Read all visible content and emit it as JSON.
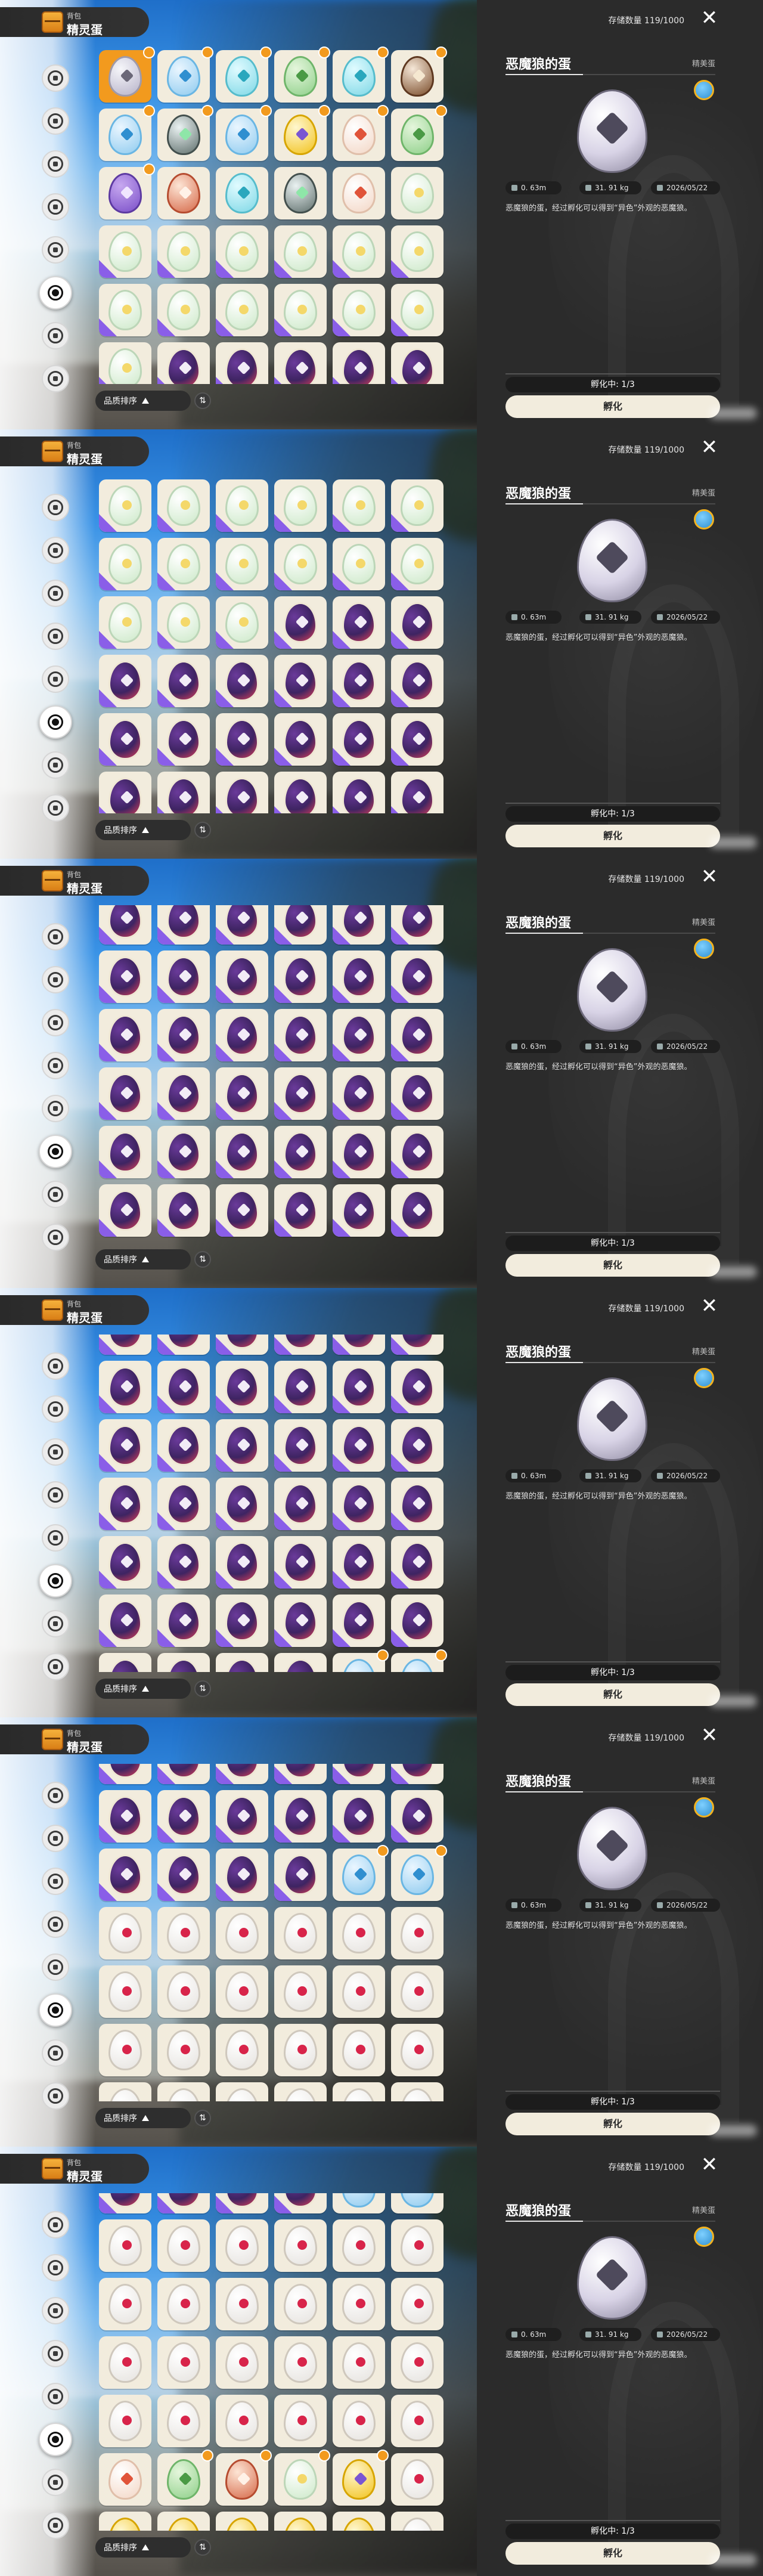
{
  "ui": {
    "category": "背包",
    "title": "精灵蛋",
    "storage": "存储数量 119/1000",
    "sort_label": "品质排序",
    "swap_glyph": "⇅",
    "close_glyph": "✕"
  },
  "detail": {
    "name": "恶魔狼的蛋",
    "kind": "精美蛋",
    "stat_size": "0. 63m",
    "stat_weight": "31. 91 kg",
    "stat_date": "2026/05/22",
    "description": "恶魔狼的蛋，经过孵化可以得到“异色”外观的恶魔狼。",
    "hatch_status": "孵化中: 1/3",
    "hatch_button": "孵化"
  },
  "sidebar": {
    "icons": [
      "ball-icon",
      "wing-icon",
      "leaf-icon",
      "drop-icon",
      "shield-icon",
      "egg-icon",
      "helmet-icon",
      "skull-icon"
    ],
    "active_index": 5
  },
  "views": [
    {
      "offset": 0,
      "rows": [
        [
          {
            "c": "grey",
            "sel": true,
            "b": true
          },
          {
            "c": "blue",
            "b": true
          },
          {
            "c": "cyan",
            "b": true
          },
          {
            "c": "green",
            "b": true
          },
          {
            "c": "cyan",
            "b": true
          },
          {
            "c": "brown",
            "b": true
          }
        ],
        [
          {
            "c": "blue",
            "b": true
          },
          {
            "c": "teal",
            "b": true
          },
          {
            "c": "blue",
            "b": true
          },
          {
            "c": "yellow",
            "b": true
          },
          {
            "c": "peach",
            "b": true
          },
          {
            "c": "green",
            "b": true
          }
        ],
        [
          {
            "c": "purple",
            "b": true
          },
          {
            "c": "red"
          },
          {
            "c": "cyan"
          },
          {
            "c": "teal"
          },
          {
            "c": "peach"
          },
          {
            "c": "mint"
          }
        ],
        [
          {
            "c": "mint",
            "t": true
          },
          {
            "c": "mint",
            "t": true
          },
          {
            "c": "mint",
            "t": true
          },
          {
            "c": "mint",
            "t": true
          },
          {
            "c": "mint",
            "t": true
          },
          {
            "c": "mint",
            "t": true
          }
        ],
        [
          {
            "c": "mint",
            "t": true
          },
          {
            "c": "mint",
            "t": true
          },
          {
            "c": "mint",
            "t": true
          },
          {
            "c": "mint",
            "t": true
          },
          {
            "c": "mint",
            "t": true
          },
          {
            "c": "mint",
            "t": true
          }
        ],
        [
          {
            "c": "mint",
            "t": true
          },
          {
            "c": "dark",
            "t": true
          },
          {
            "c": "dark",
            "t": true
          },
          {
            "c": "dark",
            "t": true
          },
          {
            "c": "dark",
            "t": true
          },
          {
            "c": "dark",
            "t": true
          }
        ]
      ]
    },
    {
      "offset": 0,
      "rows": [
        [
          {
            "c": "mint",
            "t": true
          },
          {
            "c": "mint",
            "t": true
          },
          {
            "c": "mint",
            "t": true
          },
          {
            "c": "mint",
            "t": true
          },
          {
            "c": "mint",
            "t": true
          },
          {
            "c": "mint",
            "t": true
          }
        ],
        [
          {
            "c": "mint",
            "t": true
          },
          {
            "c": "mint",
            "t": true
          },
          {
            "c": "mint",
            "t": true
          },
          {
            "c": "mint",
            "t": true
          },
          {
            "c": "mint",
            "t": true
          },
          {
            "c": "mint",
            "t": true
          }
        ],
        [
          {
            "c": "mint",
            "t": true
          },
          {
            "c": "mint",
            "t": true
          },
          {
            "c": "mint",
            "t": true
          },
          {
            "c": "dark",
            "t": true
          },
          {
            "c": "dark",
            "t": true
          },
          {
            "c": "dark",
            "t": true
          }
        ],
        [
          {
            "c": "dark",
            "t": true
          },
          {
            "c": "dark",
            "t": true
          },
          {
            "c": "dark",
            "t": true
          },
          {
            "c": "dark",
            "t": true
          },
          {
            "c": "dark",
            "t": true
          },
          {
            "c": "dark",
            "t": true
          }
        ],
        [
          {
            "c": "dark",
            "t": true
          },
          {
            "c": "dark",
            "t": true
          },
          {
            "c": "dark",
            "t": true
          },
          {
            "c": "dark",
            "t": true
          },
          {
            "c": "dark",
            "t": true
          },
          {
            "c": "dark",
            "t": true
          }
        ],
        [
          {
            "c": "dark",
            "t": true
          },
          {
            "c": "dark",
            "t": true
          },
          {
            "c": "dark",
            "t": true
          },
          {
            "c": "dark",
            "t": true
          },
          {
            "c": "dark",
            "t": true
          },
          {
            "c": "dark",
            "t": true
          }
        ]
      ]
    },
    {
      "offset": -28,
      "rows": [
        [
          {
            "c": "dark",
            "t": true
          },
          {
            "c": "dark",
            "t": true
          },
          {
            "c": "dark",
            "t": true
          },
          {
            "c": "dark",
            "t": true
          },
          {
            "c": "dark",
            "t": true
          },
          {
            "c": "dark",
            "t": true
          }
        ],
        [
          {
            "c": "dark",
            "t": true
          },
          {
            "c": "dark",
            "t": true
          },
          {
            "c": "dark",
            "t": true
          },
          {
            "c": "dark",
            "t": true
          },
          {
            "c": "dark",
            "t": true
          },
          {
            "c": "dark",
            "t": true
          }
        ],
        [
          {
            "c": "dark",
            "t": true
          },
          {
            "c": "dark",
            "t": true
          },
          {
            "c": "dark",
            "t": true
          },
          {
            "c": "dark",
            "t": true
          },
          {
            "c": "dark",
            "t": true
          },
          {
            "c": "dark",
            "t": true
          }
        ],
        [
          {
            "c": "dark",
            "t": true
          },
          {
            "c": "dark",
            "t": true
          },
          {
            "c": "dark",
            "t": true
          },
          {
            "c": "dark",
            "t": true
          },
          {
            "c": "dark",
            "t": true
          },
          {
            "c": "dark",
            "t": true
          }
        ],
        [
          {
            "c": "dark",
            "t": true
          },
          {
            "c": "dark",
            "t": true
          },
          {
            "c": "dark",
            "t": true
          },
          {
            "c": "dark",
            "t": true
          },
          {
            "c": "dark",
            "t": true
          },
          {
            "c": "dark",
            "t": true
          }
        ],
        [
          {
            "c": "dark",
            "t": true
          },
          {
            "c": "dark",
            "t": true
          },
          {
            "c": "dark",
            "t": true
          },
          {
            "c": "dark",
            "t": true
          },
          {
            "c": "dark",
            "t": true
          },
          {
            "c": "dark",
            "t": true
          }
        ],
        [
          {
            "c": "dark",
            "t": true
          },
          {
            "c": "dark",
            "t": true
          },
          {
            "c": "dark",
            "t": true
          },
          {
            "c": "dark",
            "t": true
          },
          {
            "c": "dark",
            "t": true
          },
          {
            "c": "dark",
            "t": true
          }
        ]
      ]
    },
    {
      "offset": -60,
      "rows": [
        [
          {
            "c": "dark",
            "t": true
          },
          {
            "c": "dark",
            "t": true
          },
          {
            "c": "dark",
            "t": true
          },
          {
            "c": "dark",
            "t": true
          },
          {
            "c": "dark",
            "t": true
          },
          {
            "c": "dark",
            "t": true
          }
        ],
        [
          {
            "c": "dark",
            "t": true
          },
          {
            "c": "dark",
            "t": true
          },
          {
            "c": "dark",
            "t": true
          },
          {
            "c": "dark",
            "t": true
          },
          {
            "c": "dark",
            "t": true
          },
          {
            "c": "dark",
            "t": true
          }
        ],
        [
          {
            "c": "dark",
            "t": true
          },
          {
            "c": "dark",
            "t": true
          },
          {
            "c": "dark",
            "t": true
          },
          {
            "c": "dark",
            "t": true
          },
          {
            "c": "dark",
            "t": true
          },
          {
            "c": "dark",
            "t": true
          }
        ],
        [
          {
            "c": "dark",
            "t": true
          },
          {
            "c": "dark",
            "t": true
          },
          {
            "c": "dark",
            "t": true
          },
          {
            "c": "dark",
            "t": true
          },
          {
            "c": "dark",
            "t": true
          },
          {
            "c": "dark",
            "t": true
          }
        ],
        [
          {
            "c": "dark",
            "t": true
          },
          {
            "c": "dark",
            "t": true
          },
          {
            "c": "dark",
            "t": true
          },
          {
            "c": "dark",
            "t": true
          },
          {
            "c": "dark",
            "t": true
          },
          {
            "c": "dark",
            "t": true
          }
        ],
        [
          {
            "c": "dark",
            "t": true
          },
          {
            "c": "dark",
            "t": true
          },
          {
            "c": "dark",
            "t": true
          },
          {
            "c": "dark",
            "t": true
          },
          {
            "c": "dark",
            "t": true
          },
          {
            "c": "dark",
            "t": true
          }
        ],
        [
          {
            "c": "dark",
            "t": true
          },
          {
            "c": "dark",
            "t": true
          },
          {
            "c": "dark",
            "t": true
          },
          {
            "c": "dark",
            "t": true
          },
          {
            "c": "blue",
            "b": true
          },
          {
            "c": "blue",
            "b": true
          }
        ]
      ]
    },
    {
      "offset": -60,
      "rows": [
        [
          {
            "c": "dark",
            "t": true
          },
          {
            "c": "dark",
            "t": true
          },
          {
            "c": "dark",
            "t": true
          },
          {
            "c": "dark",
            "t": true
          },
          {
            "c": "dark",
            "t": true
          },
          {
            "c": "dark",
            "t": true
          }
        ],
        [
          {
            "c": "dark",
            "t": true
          },
          {
            "c": "dark",
            "t": true
          },
          {
            "c": "dark",
            "t": true
          },
          {
            "c": "dark",
            "t": true
          },
          {
            "c": "dark",
            "t": true
          },
          {
            "c": "dark",
            "t": true
          }
        ],
        [
          {
            "c": "dark",
            "t": true
          },
          {
            "c": "dark",
            "t": true
          },
          {
            "c": "dark",
            "t": true
          },
          {
            "c": "dark",
            "t": true
          },
          {
            "c": "blue",
            "b": true
          },
          {
            "c": "blue",
            "b": true
          }
        ],
        [
          {
            "c": "white"
          },
          {
            "c": "white"
          },
          {
            "c": "white"
          },
          {
            "c": "white"
          },
          {
            "c": "white"
          },
          {
            "c": "white"
          }
        ],
        [
          {
            "c": "white"
          },
          {
            "c": "white"
          },
          {
            "c": "white"
          },
          {
            "c": "white"
          },
          {
            "c": "white"
          },
          {
            "c": "white"
          }
        ],
        [
          {
            "c": "white"
          },
          {
            "c": "white"
          },
          {
            "c": "white"
          },
          {
            "c": "white"
          },
          {
            "c": "white"
          },
          {
            "c": "white"
          }
        ],
        [
          {
            "c": "white"
          },
          {
            "c": "white"
          },
          {
            "c": "white"
          },
          {
            "c": "white"
          },
          {
            "c": "white"
          },
          {
            "c": "white"
          }
        ]
      ]
    },
    {
      "offset": -60,
      "rows": [
        [
          {
            "c": "dark",
            "t": true
          },
          {
            "c": "dark",
            "t": true
          },
          {
            "c": "dark",
            "t": true
          },
          {
            "c": "dark",
            "t": true
          },
          {
            "c": "blue",
            "b": true
          },
          {
            "c": "blue",
            "b": true
          }
        ],
        [
          {
            "c": "white"
          },
          {
            "c": "white"
          },
          {
            "c": "white"
          },
          {
            "c": "white"
          },
          {
            "c": "white"
          },
          {
            "c": "white"
          }
        ],
        [
          {
            "c": "white"
          },
          {
            "c": "white"
          },
          {
            "c": "white"
          },
          {
            "c": "white"
          },
          {
            "c": "white"
          },
          {
            "c": "white"
          }
        ],
        [
          {
            "c": "white"
          },
          {
            "c": "white"
          },
          {
            "c": "white"
          },
          {
            "c": "white"
          },
          {
            "c": "white"
          },
          {
            "c": "white"
          }
        ],
        [
          {
            "c": "white"
          },
          {
            "c": "white"
          },
          {
            "c": "white"
          },
          {
            "c": "white"
          },
          {
            "c": "white"
          },
          {
            "c": "white"
          }
        ],
        [
          {
            "c": "peach"
          },
          {
            "c": "green",
            "b": true
          },
          {
            "c": "red",
            "b": true
          },
          {
            "c": "mint",
            "b": true
          },
          {
            "c": "yellow",
            "b": true
          },
          {
            "c": "white"
          }
        ],
        [
          {
            "c": "yellow",
            "t": true
          },
          {
            "c": "yellow",
            "t": true
          },
          {
            "c": "yellow",
            "t": true
          },
          {
            "c": "yellow",
            "t": true
          },
          {
            "c": "yellow",
            "t": true
          },
          {
            "c": "white"
          }
        ]
      ]
    }
  ]
}
